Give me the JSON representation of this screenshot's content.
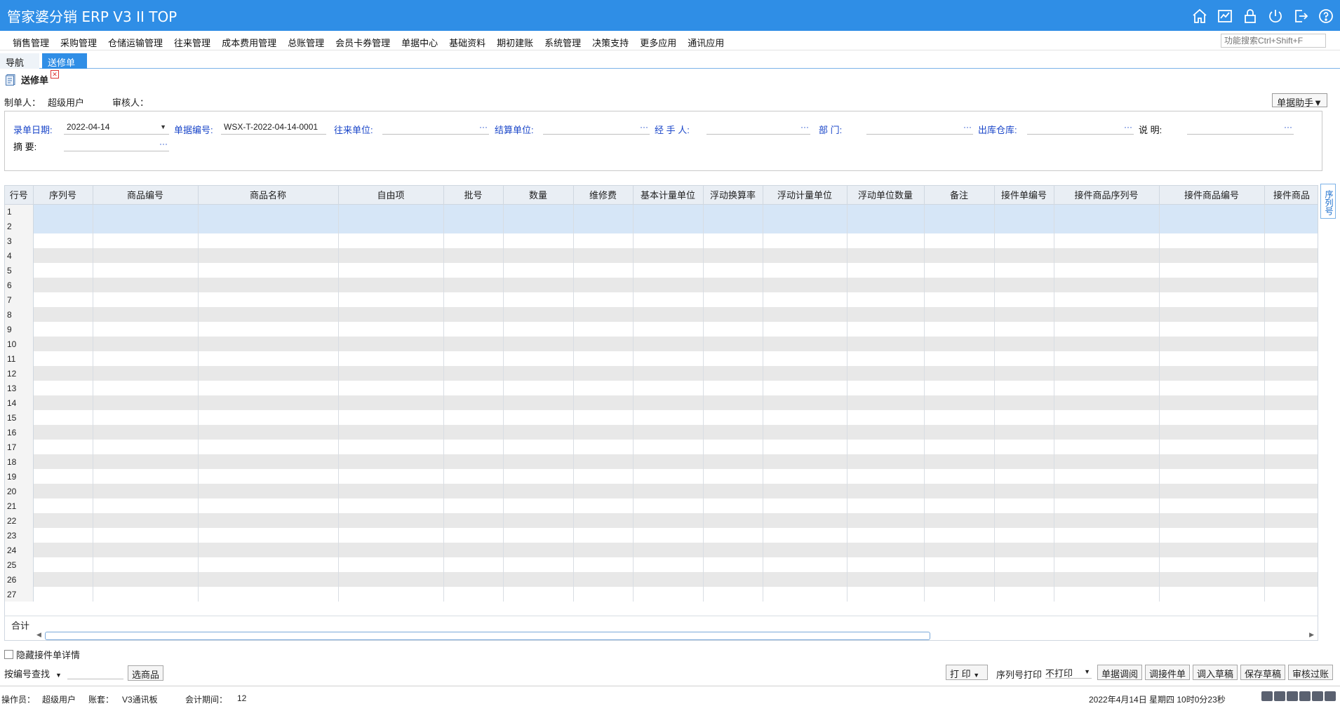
{
  "app": {
    "title": "管家婆分销 ERP V3 II TOP"
  },
  "menu": {
    "items": [
      "销售管理",
      "采购管理",
      "仓储运输管理",
      "往来管理",
      "成本费用管理",
      "总账管理",
      "会员卡券管理",
      "单据中心",
      "基础资料",
      "期初建账",
      "系统管理",
      "决策支持",
      "更多应用",
      "通讯应用"
    ],
    "search_placeholder": "功能搜索Ctrl+Shift+F"
  },
  "tabs": {
    "nav": "导航",
    "active": "送修单"
  },
  "doc": {
    "title": "送修单",
    "maker_label": "制单人：",
    "maker_value": "超级用户",
    "auditor_label": "审核人：",
    "helper_button": "单据助手▼"
  },
  "form": {
    "date_label": "录单日期:",
    "date_value": "2022-04-14",
    "number_label": "单据编号:",
    "number_value": "WSX-T-2022-04-14-0001",
    "partner_label": "往来单位:",
    "settle_label": "结算单位:",
    "handler_label": "经 手 人:",
    "dept_label": "部    门:",
    "warehouse_label": "出库仓库:",
    "note_label": "说    明:",
    "summary_label": "摘    要:",
    "dots": "···"
  },
  "grid": {
    "columns": [
      "行号",
      "序列号",
      "商品编号",
      "商品名称",
      "自由项",
      "批号",
      "数量",
      "维修费",
      "基本计量单位",
      "浮动换算率",
      "浮动计量单位",
      "浮动单位数量",
      "备注",
      "接件单编号",
      "接件商品序列号",
      "接件商品编号",
      "接件商品"
    ],
    "rows": [
      "1",
      "2",
      "3",
      "4",
      "5",
      "6",
      "7",
      "8",
      "9",
      "10",
      "11",
      "12",
      "13",
      "14",
      "15",
      "16",
      "17",
      "18",
      "19",
      "20",
      "21",
      "22",
      "23",
      "24",
      "25",
      "26",
      "27"
    ],
    "total_label": "合计",
    "side_tab": "序列号"
  },
  "bottom": {
    "hide_detail": "隐藏接件单详情",
    "search_mode": "按编号查找",
    "pick_goods": "选商品",
    "print": "打 印",
    "serial_print_label": "序列号打印",
    "serial_print_value": "不打印",
    "buttons": [
      "单据调阅",
      "调接件单",
      "调入草稿",
      "保存草稿",
      "审核过账"
    ]
  },
  "status": {
    "operator_label": "操作员：",
    "operator": "超级用户",
    "account_label": "账套：",
    "account": "V3通讯板",
    "period_label": "会计期间：",
    "period": "12",
    "datetime": "2022年4月14日  星期四  10时0分23秒"
  },
  "colors": {
    "brand": "#2f8ee6",
    "label_blue": "#1a46c9",
    "row_alt": "#e8e8e8",
    "row_selected": "#d6e6f7"
  },
  "icons": [
    "home-icon",
    "chart-icon",
    "lock-icon",
    "power-icon",
    "exit-icon",
    "help-icon"
  ]
}
